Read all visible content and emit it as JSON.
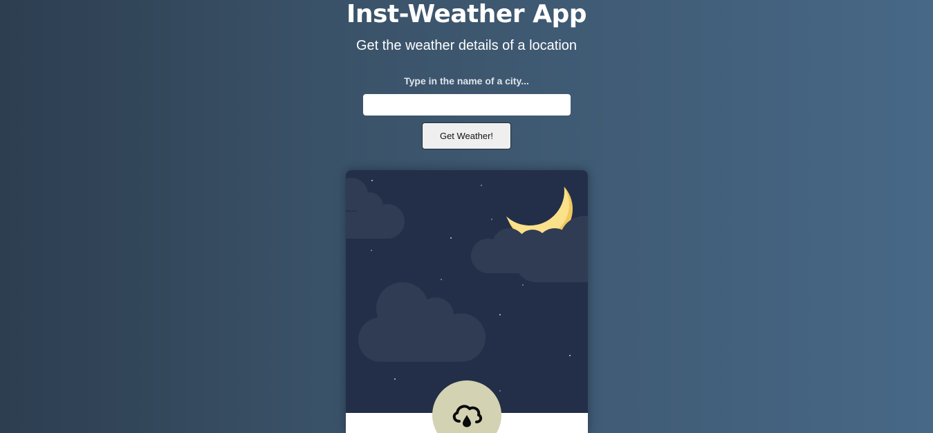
{
  "app": {
    "title": "Inst-Weather App",
    "subtitle": "Get the weather details of a location"
  },
  "search": {
    "label": "Type in the name of a city...",
    "value": "",
    "placeholder": ""
  },
  "actions": {
    "get_weather_label": "Get Weather!"
  },
  "weather_card": {
    "scene": "night",
    "scene_icons": [
      "crescent-moon-icon",
      "cloud-icon",
      "star-icon"
    ],
    "condition_icon": "rain-cloud-icon"
  },
  "colors": {
    "card_sky": "#232f48",
    "cloud": "#2f3c54",
    "moon": "#fbe18a",
    "icon_circle": "#d3d2b3"
  }
}
